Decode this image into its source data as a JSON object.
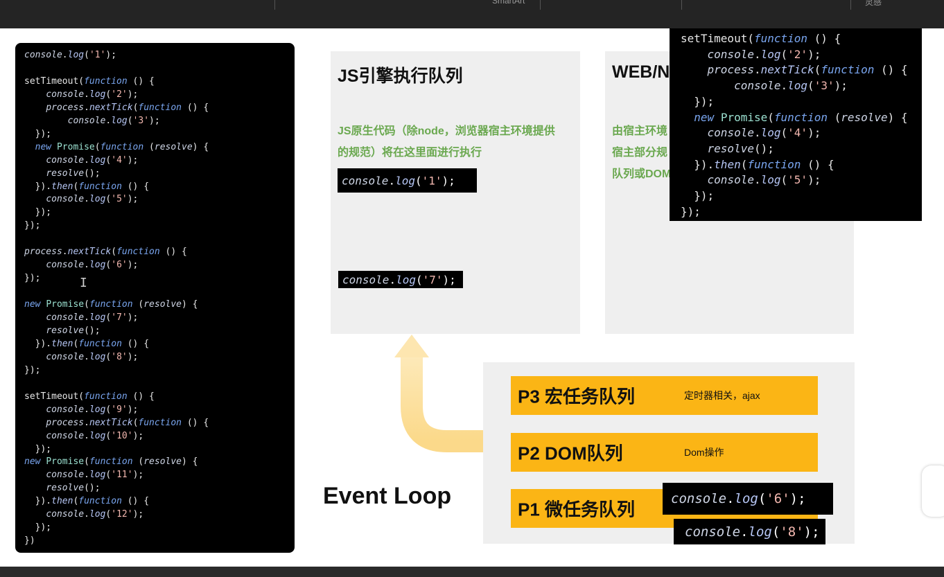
{
  "toolbar": {
    "smartart_label": "SmartArt",
    "inspiration_label": "灵感"
  },
  "left_code": [
    "console.log('1');",
    "",
    "setTimeout(function () {",
    "    console.log('2');",
    "    process.nextTick(function () {",
    "        console.log('3');",
    "  });",
    "  new Promise(function (resolve) {",
    "    console.log('4');",
    "    resolve();",
    "  }).then(function () {",
    "    console.log('5');",
    "  });",
    "});",
    "",
    "process.nextTick(function () {",
    "    console.log('6');",
    "});",
    "",
    "new Promise(function (resolve) {",
    "    console.log('7');",
    "    resolve();",
    "  }).then(function () {",
    "    console.log('8');",
    "});",
    "",
    "setTimeout(function () {",
    "    console.log('9');",
    "    process.nextTick(function () {",
    "    console.log('10');",
    "  });",
    "new Promise(function (resolve) {",
    "    console.log('11');",
    "    resolve();",
    "  }).then(function () {",
    "    console.log('12');",
    "  });",
    "})"
  ],
  "js_panel": {
    "title": "JS引擎执行队列",
    "desc_line1": "JS原生代码（除node，浏览器宿主环境提供",
    "desc_line2": "的规范）将在这里面进行执行",
    "chip1": "console.log('1');",
    "chip2": "console.log('7');"
  },
  "web_panel": {
    "title": "WEB/N",
    "desc_line1": "由宿主环境",
    "desc_line2": "宿主部分规",
    "desc_line3": "队列或DOM"
  },
  "overlay_code": [
    "setTimeout(function () {",
    "    console.log('2');",
    "    process.nextTick(function () {",
    "        console.log('3');",
    "  });",
    "  new Promise(function (resolve) {",
    "    console.log('4');",
    "    resolve();",
    "  }).then(function () {",
    "    console.log('5');",
    "  });",
    "});"
  ],
  "queues": [
    {
      "name": "P3 宏任务队列",
      "desc": "定时器相关，ajax"
    },
    {
      "name": "P2 DOM队列",
      "desc": "Dom操作"
    },
    {
      "name": "P1 微任务队列",
      "desc": ""
    }
  ],
  "event_loop_label": "Event Loop",
  "micro_chips": [
    "console.log('6');",
    "console.log('8');"
  ],
  "colors": {
    "queue_fill": "#fbb515",
    "arrow": "#fde2a4",
    "desc_green": "#6aa84f",
    "panel_bg": "#efefef"
  }
}
